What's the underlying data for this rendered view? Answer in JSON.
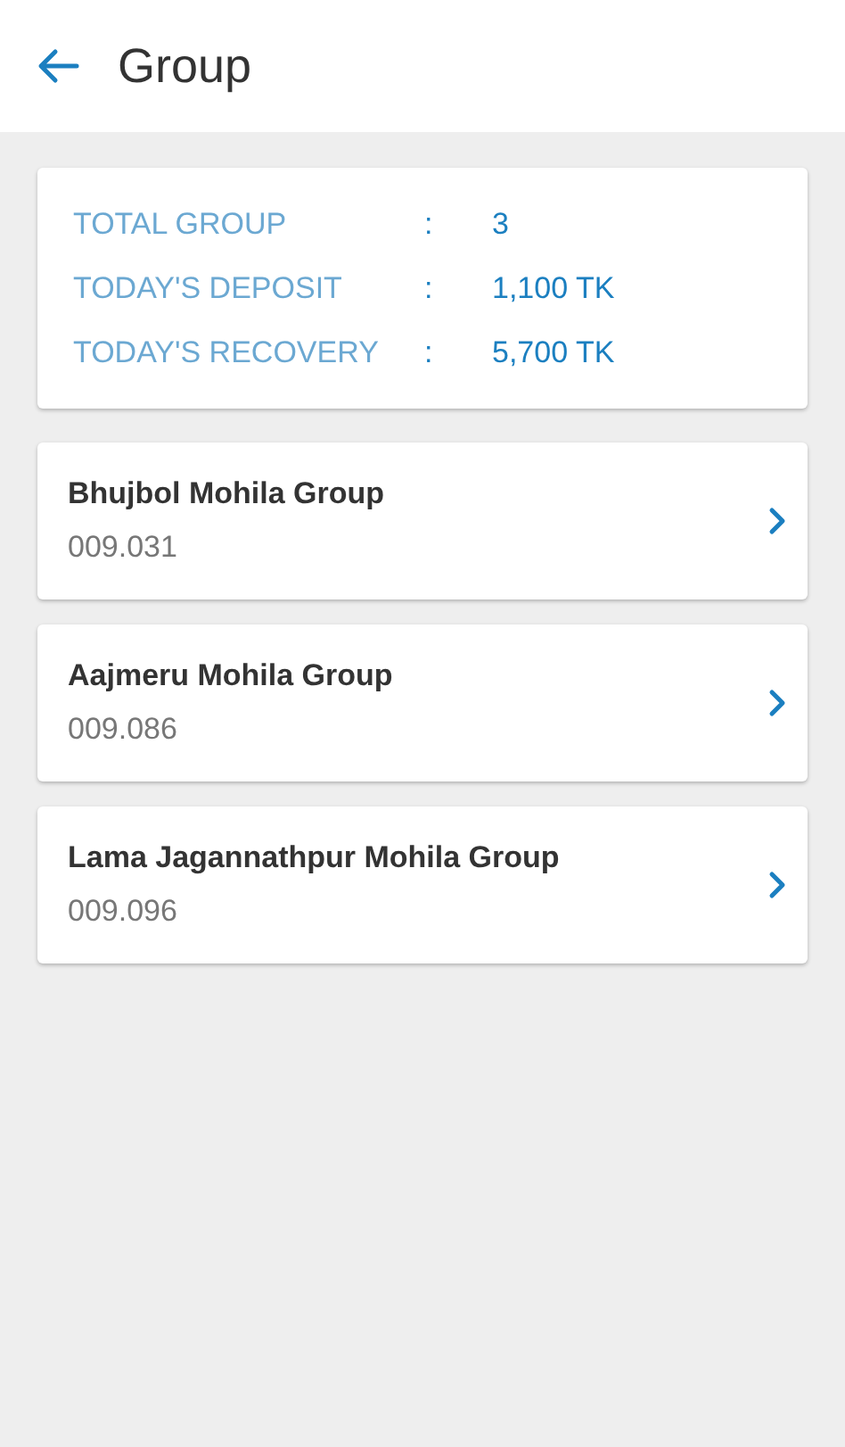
{
  "header": {
    "title": "Group"
  },
  "summary": [
    {
      "label": "TOTAL GROUP",
      "separator": ":",
      "value": "3"
    },
    {
      "label": "TODAY'S DEPOSIT",
      "separator": ":",
      "value": "1,100 TK"
    },
    {
      "label": "TODAY'S RECOVERY",
      "separator": ":",
      "value": "5,700 TK"
    }
  ],
  "groups": [
    {
      "name": "Bhujbol Mohila Group",
      "code": "009.031"
    },
    {
      "name": "Aajmeru Mohila Group",
      "code": "009.086"
    },
    {
      "name": "Lama Jagannathpur Mohila Group",
      "code": "009.096"
    }
  ]
}
